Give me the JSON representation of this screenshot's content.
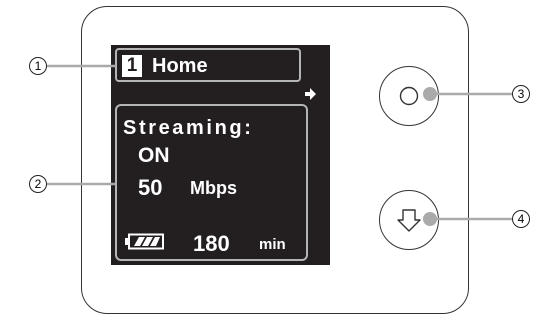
{
  "display": {
    "page_number": "1",
    "page_title": "Home",
    "streaming_label": "Streaming:",
    "streaming_state": "ON",
    "bitrate_value": "50",
    "bitrate_unit": "Mbps",
    "remaining_time_value": "180",
    "remaining_time_unit": "min"
  },
  "callouts": [
    "1",
    "2",
    "3",
    "4"
  ],
  "icons": {
    "next_page": "right-arrow-icon",
    "battery": "battery-icon",
    "select_button": "circle-icon",
    "down_button": "down-arrow-icon"
  },
  "colors": {
    "screen": "#231f20",
    "highlight_border": "#b5b5b5",
    "callout_line": "#aaaaaa",
    "text": "#ffffff"
  }
}
